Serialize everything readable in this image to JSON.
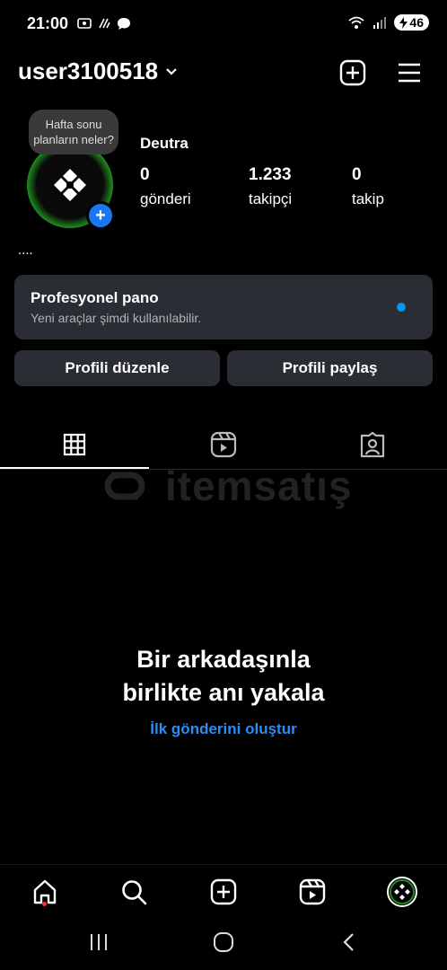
{
  "status_bar": {
    "time": "21:00",
    "battery": "46"
  },
  "header": {
    "username": "user3100518"
  },
  "profile": {
    "note": "Hafta sonu planların neler?",
    "display_name": "Deutra",
    "stats": [
      {
        "value": "0",
        "label": "gönderi"
      },
      {
        "value": "1.233",
        "label": "takipçi"
      },
      {
        "value": "0",
        "label": "takip"
      }
    ],
    "bio": "...."
  },
  "pro_dashboard": {
    "title": "Profesyonel pano",
    "subtitle": "Yeni araçlar şimdi kullanılabilir."
  },
  "buttons": {
    "edit": "Profili düzenle",
    "share": "Profili paylaş"
  },
  "watermark": {
    "text": "itemsatış"
  },
  "empty_state": {
    "title_line1": "Bir arkadaşınla",
    "title_line2": "birlikte anı yakala",
    "link": "İlk gönderini oluştur"
  },
  "colors": {
    "accent": "#0095f6",
    "card": "#2a2d33",
    "notification": "#ff3040"
  }
}
